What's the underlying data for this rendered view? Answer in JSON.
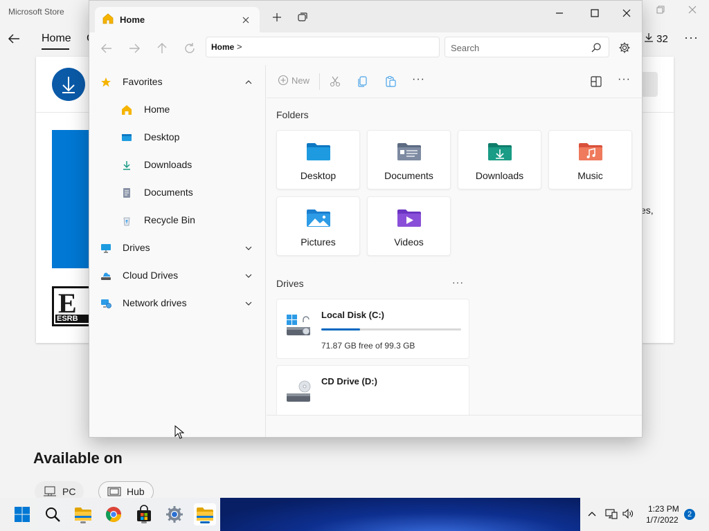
{
  "store": {
    "window_title": "Microsoft Store",
    "nav_home": "Home",
    "nav_partial": "C",
    "download_count": "32",
    "esrb_letter": "E",
    "esrb_text": "ESRB",
    "partial_text": "es,",
    "available_on": "Available on",
    "chips": [
      {
        "label": "PC",
        "icon": "pc-icon"
      },
      {
        "label": "Hub",
        "icon": "hub-icon"
      }
    ]
  },
  "explorer": {
    "tab_title": "Home",
    "address": {
      "root": "Home",
      "chevron": ">"
    },
    "search": {
      "placeholder": "Search"
    },
    "toolbar": {
      "new_label": "New",
      "more": "···"
    },
    "sidebar": [
      {
        "label": "Favorites",
        "icon": "star-icon",
        "level": 0,
        "expand": "up"
      },
      {
        "label": "Home",
        "icon": "home-icon",
        "level": 1
      },
      {
        "label": "Desktop",
        "icon": "desktop-icon",
        "level": 1
      },
      {
        "label": "Downloads",
        "icon": "downloads-icon",
        "level": 1
      },
      {
        "label": "Documents",
        "icon": "documents-icon",
        "level": 1
      },
      {
        "label": "Recycle Bin",
        "icon": "recycle-bin-icon",
        "level": 1
      },
      {
        "label": "Drives",
        "icon": "monitor-icon",
        "level": 0,
        "expand": "down"
      },
      {
        "label": "Cloud Drives",
        "icon": "cloud-drive-icon",
        "level": 0,
        "expand": "down"
      },
      {
        "label": "Network drives",
        "icon": "network-icon",
        "level": 0,
        "expand": "down"
      }
    ],
    "folders_header": "Folders",
    "folders": [
      {
        "label": "Desktop",
        "icon": "desktop-folder-icon",
        "color": "#1e9be0"
      },
      {
        "label": "Documents",
        "icon": "documents-folder-icon",
        "color": "#6d7c95"
      },
      {
        "label": "Downloads",
        "icon": "downloads-folder-icon",
        "color": "#1a9c86"
      },
      {
        "label": "Music",
        "icon": "music-folder-icon",
        "color": "#e8644e"
      },
      {
        "label": "Pictures",
        "icon": "pictures-folder-icon",
        "color": "#2d9be6"
      },
      {
        "label": "Videos",
        "icon": "videos-folder-icon",
        "color": "#8a4fd8"
      }
    ],
    "drives_header": "Drives",
    "drives_more": "···",
    "drives": [
      {
        "name": "Local Disk (C:)",
        "free_text": "71.87 GB free of 99.3 GB",
        "used_fraction": 0.276
      },
      {
        "name": "CD Drive (D:)"
      }
    ]
  },
  "taskbar": {
    "apps": [
      "start-icon",
      "search-icon",
      "file-explorer-icon",
      "chrome-icon",
      "store-icon",
      "settings-icon",
      "file-explorer-active-icon"
    ],
    "time": "1:23 PM",
    "date": "1/7/2022",
    "notifications": "2"
  },
  "colors": {
    "accent": "#0067c0",
    "favorites_star": "#f5b400"
  }
}
